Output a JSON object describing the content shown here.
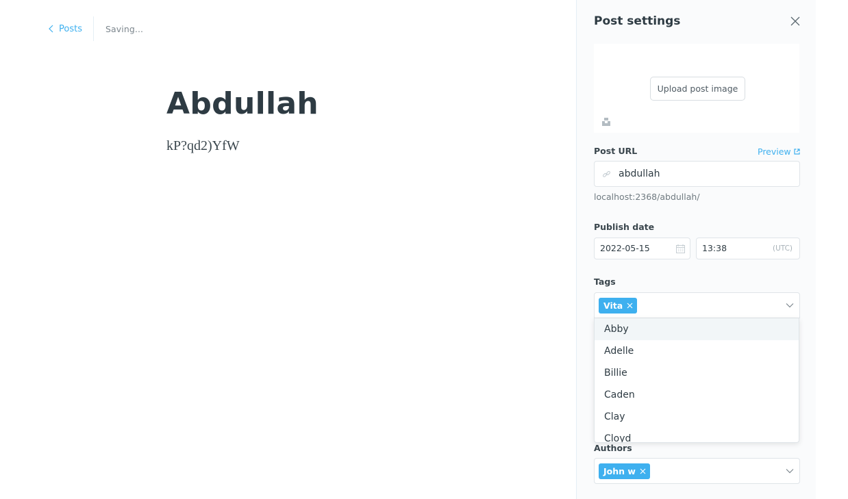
{
  "editor": {
    "back_label": "Posts",
    "save_status": "Saving...",
    "title": "Abdullah",
    "body": "kP?qd2)YfW"
  },
  "settings": {
    "title": "Post settings",
    "upload_label": "Upload post image",
    "post_url": {
      "label": "Post URL",
      "preview_label": "Preview",
      "value": "abdullah",
      "helper": "localhost:2368/abdullah/"
    },
    "publish_date": {
      "label": "Publish date",
      "date": "2022-05-15",
      "time": "13:38",
      "timezone": "(UTC)"
    },
    "tags": {
      "label": "Tags",
      "selected": [
        "Vita"
      ],
      "options": [
        "Abby",
        "Adelle",
        "Billie",
        "Caden",
        "Clay",
        "Cloyd"
      ],
      "highlighted_index": 0
    },
    "authors": {
      "label": "Authors",
      "selected": [
        "John w"
      ]
    }
  },
  "icons": {
    "back": "chevron-left-icon",
    "close": "close-icon",
    "unsplash": "unsplash-icon",
    "preview": "external-link-icon",
    "link": "link-icon",
    "calendar": "calendar-icon",
    "token_remove": "close-small-icon",
    "dropdown": "chevron-down-icon"
  },
  "colors": {
    "accent": "#3eb0ef",
    "title_text": "#2e3b43",
    "muted_text": "#7d878e",
    "panel_bg": "#fafbfc"
  }
}
